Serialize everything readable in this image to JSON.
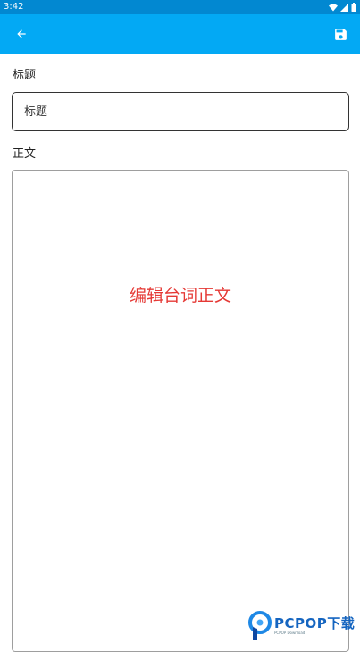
{
  "status_bar": {
    "time": "3:42",
    "icons": [
      "wifi-icon",
      "signal-icon",
      "battery-icon"
    ]
  },
  "app_bar": {
    "color": "#03a9f4",
    "back_icon": "arrow-left-icon",
    "save_icon": "floppy-disk-icon"
  },
  "form": {
    "title_label": "标题",
    "title_placeholder": "标题",
    "title_value": "",
    "body_label": "正文",
    "body_placeholder": "编辑台词正文",
    "body_value": "",
    "placeholder_color": "#e53935"
  },
  "watermark": {
    "text": "PCPOP下载",
    "subtext": "PCPOP Download"
  }
}
